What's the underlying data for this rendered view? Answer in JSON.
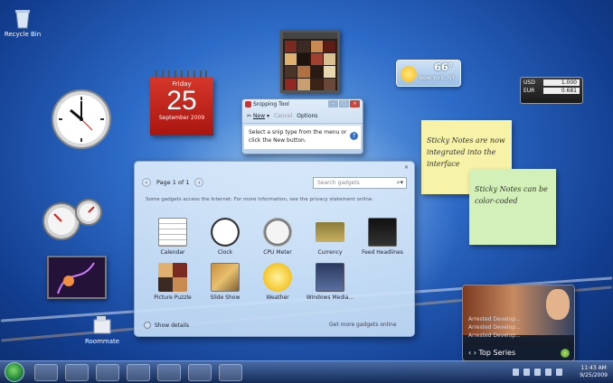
{
  "desktop": {
    "recycle_bin": "Recycle Bin",
    "folder_icon_label": "Roommate"
  },
  "calendar": {
    "day_name": "Friday",
    "day_number": "25",
    "month_year": "September 2009"
  },
  "weather": {
    "temperature": "66°",
    "city": "New York, NY"
  },
  "currency": {
    "rows": [
      {
        "code": "USD",
        "value": "1.000"
      },
      {
        "code": "EUR",
        "value": "0.681"
      }
    ]
  },
  "sticky_notes": [
    {
      "text": "Sticky Notes are now integrated into the interface",
      "color": "#f6f2a8"
    },
    {
      "text": "Sticky Notes can be color-coded",
      "color": "#d3f0b8"
    }
  ],
  "snipping_tool": {
    "title": "Snipping Tool",
    "new_label": "New",
    "cancel_label": "Cancel",
    "options_label": "Options",
    "message": "Select a snip type from the menu or click the New button."
  },
  "gadget_gallery": {
    "page_indicator": "Page 1 of 1",
    "search_placeholder": "Search gadgets",
    "info_text": "Some gadgets access the Internet. For more information, see the privacy statement online.",
    "gadgets": [
      {
        "name": "Calendar"
      },
      {
        "name": "Clock"
      },
      {
        "name": "CPU Meter"
      },
      {
        "name": "Currency"
      },
      {
        "name": "Feed Headlines"
      },
      {
        "name": "Picture Puzzle"
      },
      {
        "name": "Slide Show"
      },
      {
        "name": "Weather"
      },
      {
        "name": "Windows Media..."
      }
    ],
    "show_details": "Show details",
    "get_more": "Get more gadgets online"
  },
  "media_center": {
    "list": [
      "Arrested Develop...",
      "Arrested Develop...",
      "Arrested Develop..."
    ],
    "footer_label": "Top Series"
  },
  "taskbar": {
    "time": "11:43 AM",
    "date": "9/25/2009"
  },
  "colors": {
    "accent": "#2d6bc8",
    "calendar_red": "#c9281c"
  }
}
